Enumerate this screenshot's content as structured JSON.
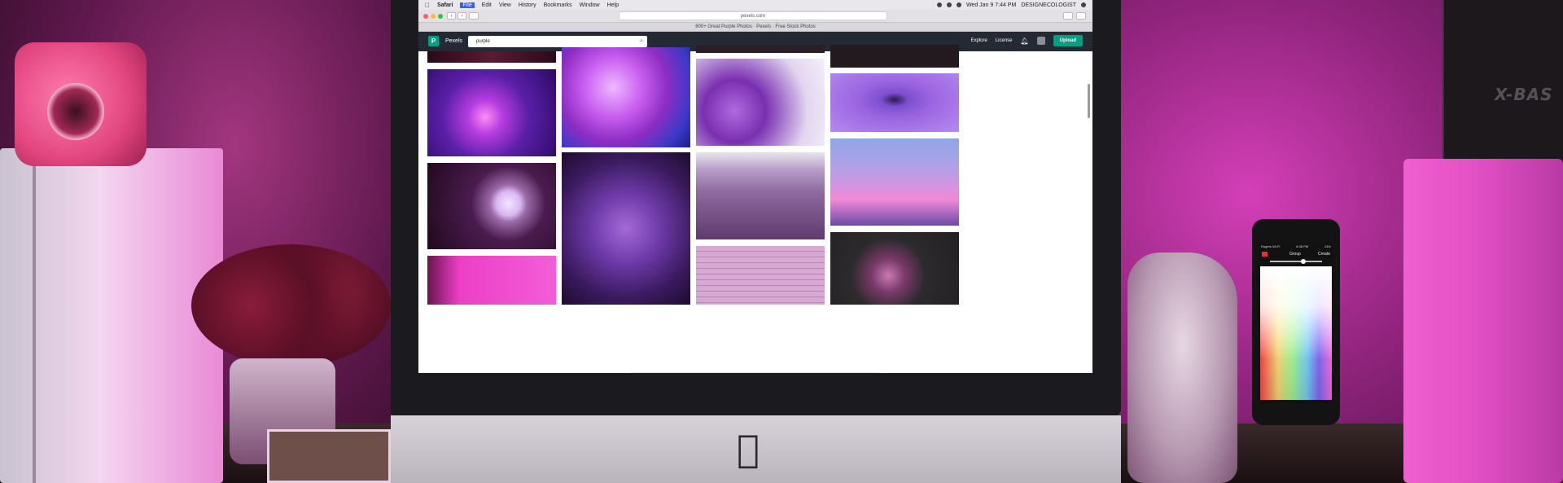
{
  "menubar": {
    "apple_icon": "",
    "items": [
      "Safari",
      "File",
      "Edit",
      "View",
      "History",
      "Bookmarks",
      "Window",
      "Help"
    ],
    "active_item": "File",
    "clock": "Wed Jan 9  7:44 PM",
    "user": "DESIGNECOLOGIST"
  },
  "browser": {
    "url": "pexels.com",
    "tab_title": "600+ Great Purple Photos · Pexels · Free Stock Photos"
  },
  "pexels": {
    "logo_letter": "P",
    "logo_text": "Pexels",
    "search_value": "purple",
    "nav": {
      "explore": "Explore",
      "license": "License",
      "upload": "Upload"
    }
  },
  "speaker": {
    "text": "X-BAS"
  },
  "phone": {
    "carrier": "Rogers Wi-Fi",
    "time": "6:38 PM",
    "battery": "24%",
    "title": "Group",
    "action": "Create"
  },
  "apple_logo": "",
  "photos": [
    {
      "name": "photo-dark-top",
      "color": "#3a0d1f"
    },
    {
      "name": "photo-fiber-optic",
      "color": "#5b1fa8"
    },
    {
      "name": "photo-daisy",
      "color": "#4a1c4e"
    },
    {
      "name": "photo-pink-fabric",
      "color": "#ec3fc7"
    },
    {
      "name": "photo-smoke",
      "color": "#b14ad6"
    },
    {
      "name": "photo-flower-field",
      "color": "#5a2d8a"
    },
    {
      "name": "photo-balloons",
      "color": "#7a2fb0"
    },
    {
      "name": "photo-lavender-field",
      "color": "#8e6aa0"
    },
    {
      "name": "photo-pink-wall-window",
      "color": "#c9a0c7"
    },
    {
      "name": "photo-dark-strip",
      "color": "#2a1f24"
    },
    {
      "name": "photo-water-drop",
      "color": "#9b64e0"
    },
    {
      "name": "photo-birds-sky",
      "color": "#a585d8"
    },
    {
      "name": "photo-dark-flower",
      "color": "#2c2a2d"
    }
  ]
}
